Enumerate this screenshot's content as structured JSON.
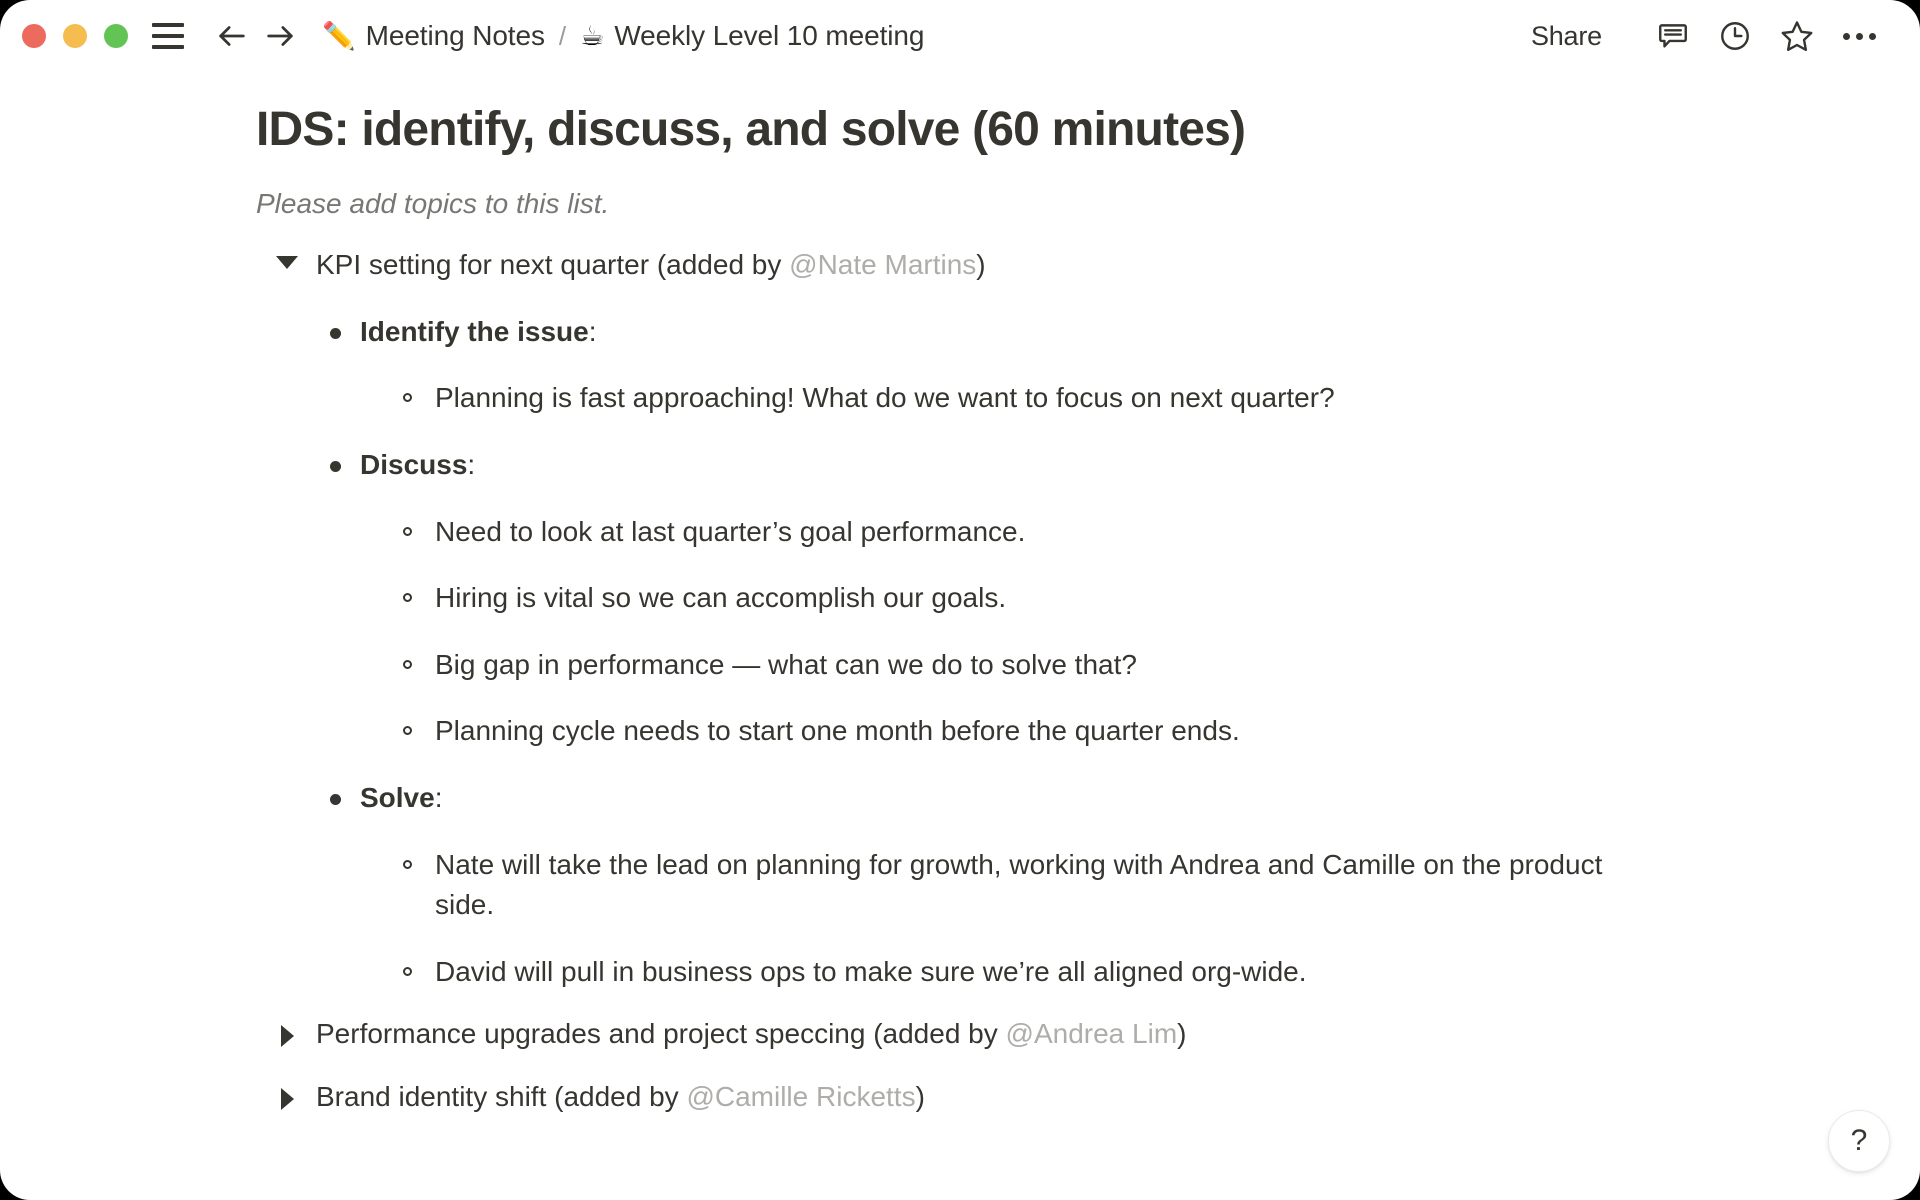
{
  "window": {
    "traffic_lights": [
      {
        "name": "close",
        "color": "#ED6A5E"
      },
      {
        "name": "minimize",
        "color": "#F5BD4F"
      },
      {
        "name": "maximize",
        "color": "#61C454"
      }
    ]
  },
  "topbar": {
    "menu_icon": "hamburger-icon",
    "back_icon": "arrow-left-icon",
    "forward_icon": "arrow-right-icon",
    "breadcrumb": [
      {
        "emoji": "✏️",
        "label": "Meeting Notes"
      },
      {
        "emoji": "☕",
        "label": "Weekly Level 10 meeting"
      }
    ],
    "separator": "/",
    "share_label": "Share",
    "actions": [
      {
        "name": "comment-icon",
        "label": "Comments"
      },
      {
        "name": "history-icon",
        "label": "Updates"
      },
      {
        "name": "star-icon",
        "label": "Favorite"
      },
      {
        "name": "more-icon",
        "label": "More"
      }
    ]
  },
  "page": {
    "title": "IDS: identify, discuss, and solve (60 minutes)",
    "subtitle": "Please add topics to this list.",
    "toggles": [
      {
        "expanded": true,
        "text_prefix": "KPI setting for next quarter (added by ",
        "mention": "@Nate Martins",
        "text_suffix": ")",
        "sections": [
          {
            "label": "Identify the issue",
            "label_suffix": ":",
            "items": [
              "Planning is fast approaching! What do we want to focus on next quarter?"
            ]
          },
          {
            "label": "Discuss",
            "label_suffix": ":",
            "items": [
              "Need to look at last quarter’s goal performance.",
              "Hiring is vital so we can accomplish our goals.",
              "Big gap in performance — what can we do to solve that?",
              "Planning cycle needs to start one month before the quarter ends."
            ]
          },
          {
            "label": "Solve",
            "label_suffix": ":",
            "items": [
              "Nate will take the lead on planning for growth, working with Andrea and Camille on the product side.",
              "David will pull in business ops to make sure we’re all aligned org-wide."
            ]
          }
        ]
      },
      {
        "expanded": false,
        "text_prefix": "Performance upgrades and project speccing (added by ",
        "mention": "@Andrea Lim",
        "text_suffix": ")",
        "sections": []
      },
      {
        "expanded": false,
        "text_prefix": "Brand identity shift (added by ",
        "mention": "@Camille Ricketts",
        "text_suffix": ")",
        "sections": []
      }
    ]
  },
  "help": {
    "label": "?"
  },
  "colors": {
    "text": "#37352f",
    "muted": "#787774",
    "mention": "#aeadaa",
    "background": "#ffffff"
  }
}
